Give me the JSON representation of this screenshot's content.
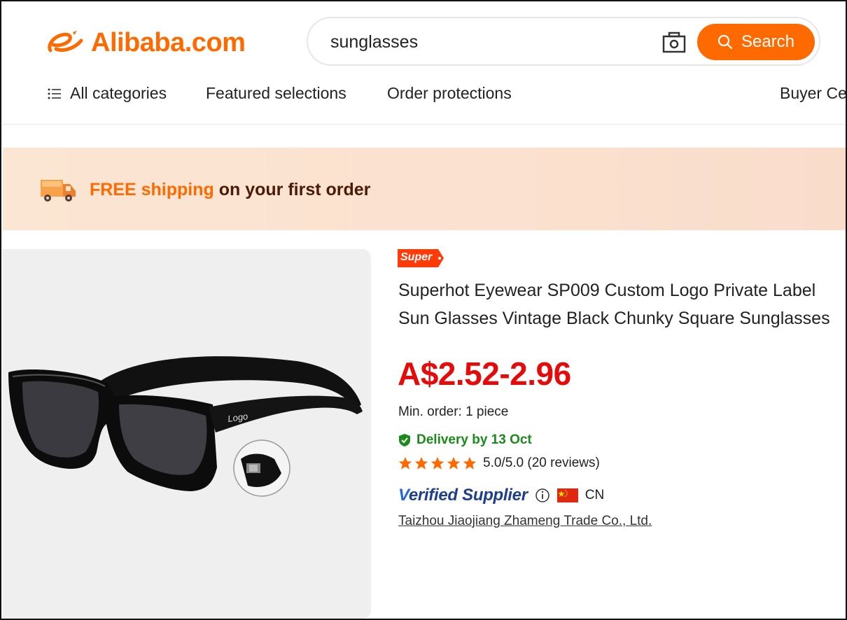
{
  "header": {
    "logo_text": "Alibaba.com",
    "search": {
      "value": "sunglasses",
      "button_label": "Search",
      "camera_icon": "camera-icon",
      "search_icon": "search-icon"
    },
    "brand_color": "#ff6a00"
  },
  "nav": {
    "items": [
      {
        "label": "All categories",
        "icon": "menu-icon"
      },
      {
        "label": "Featured selections"
      },
      {
        "label": "Order protections"
      },
      {
        "label": "Buyer Ce"
      }
    ]
  },
  "banner": {
    "icon": "truck-icon",
    "highlight": "FREE shipping",
    "rest": " on your first order"
  },
  "product": {
    "badge": "Super",
    "title_lines": [
      "Superhot Eyewear SP009 Custom Logo Private Label",
      "Sun Glasses Vintage Black Chunky Square Sunglasses"
    ],
    "price": "A$2.52-2.96",
    "price_color": "#e50b0b",
    "min_order": "Min. order: 1 piece",
    "delivery": "Delivery by 13 Oct",
    "delivery_color": "#1a8a1a",
    "rating": {
      "stars": 5,
      "text": "5.0/5.0 (20 reviews)"
    },
    "verified": {
      "label_prefix": "V",
      "label_rest": "erified Supplier",
      "country": "CN",
      "flag_icon": "china-flag-icon"
    },
    "supplier": "Taizhou Jiaojiang Zhameng Trade Co., Ltd.",
    "image": {
      "logo_text": "Logo"
    }
  }
}
